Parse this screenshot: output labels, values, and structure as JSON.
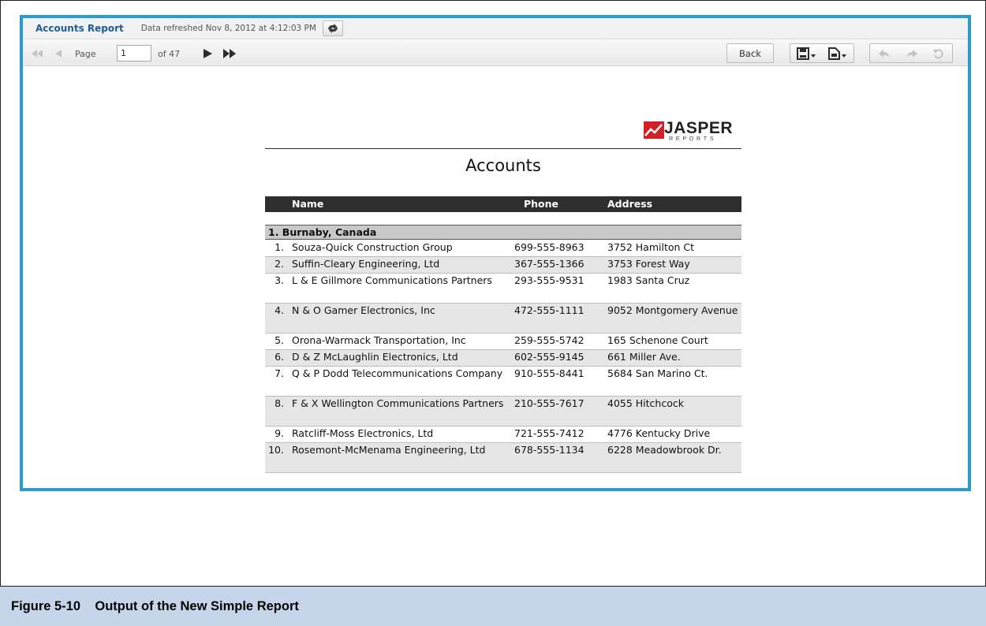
{
  "header": {
    "title": "Accounts Report",
    "refresh_text": "Data refreshed Nov 8, 2012 at 4:12:03 PM"
  },
  "toolbar": {
    "page_label": "Page",
    "page_value": "1",
    "of_label": "of 47",
    "back_label": "Back"
  },
  "report": {
    "logo": {
      "main": "JASPER",
      "sub": "REPORTS"
    },
    "title": "Accounts",
    "columns": {
      "name": "Name",
      "phone": "Phone",
      "address": "Address"
    },
    "group": "1. Burnaby, Canada",
    "rows": [
      {
        "num": "1.",
        "name": "Souza-Quick Construction Group",
        "phone": "699-555-8963",
        "address": "3752 Hamilton Ct"
      },
      {
        "num": "2.",
        "name": "Suffin-Cleary Engineering, Ltd",
        "phone": "367-555-1366",
        "address": "3753 Forest Way"
      },
      {
        "num": "3.",
        "name": "L & E Gillmore Communications Partners",
        "phone": "293-555-9531",
        "address": "1983 Santa Cruz"
      },
      {
        "num": "4.",
        "name": "N & O Gamer Electronics, Inc",
        "phone": "472-555-1111",
        "address": "9052 Montgomery Avenue"
      },
      {
        "num": "5.",
        "name": "Orona-Warmack Transportation, Inc",
        "phone": "259-555-5742",
        "address": "165 Schenone Court"
      },
      {
        "num": "6.",
        "name": "D & Z McLaughlin Electronics, Ltd",
        "phone": "602-555-9145",
        "address": "661 Miller Ave."
      },
      {
        "num": "7.",
        "name": "Q & P Dodd Telecommunications Company",
        "phone": "910-555-8441",
        "address": "5684 San Marino Ct."
      },
      {
        "num": "8.",
        "name": "F & X Wellington Communications Partners",
        "phone": "210-555-7617",
        "address": "4055 Hitchcock"
      },
      {
        "num": "9.",
        "name": "Ratcliff-Moss Electronics, Ltd",
        "phone": "721-555-7412",
        "address": "4776 Kentucky Drive"
      },
      {
        "num": "10.",
        "name": "Rosemont-McMenama Engineering, Ltd",
        "phone": "678-555-1134",
        "address": "6228 Meadowbrook Dr."
      }
    ]
  },
  "caption": "Figure 5-10    Output of the New Simple Report",
  "icons": [
    "refresh-icon",
    "first-page-icon",
    "previous-page-icon",
    "next-page-icon",
    "last-page-icon",
    "save-icon",
    "export-icon",
    "undo-icon",
    "redo-icon",
    "undo-all-icon",
    "jasper-logo-icon"
  ],
  "colors": {
    "frame_blue": "#2a9bd1",
    "title_blue": "#1d5e9a",
    "caption_bg": "#c6d6ea",
    "logo_red": "#d22027"
  }
}
